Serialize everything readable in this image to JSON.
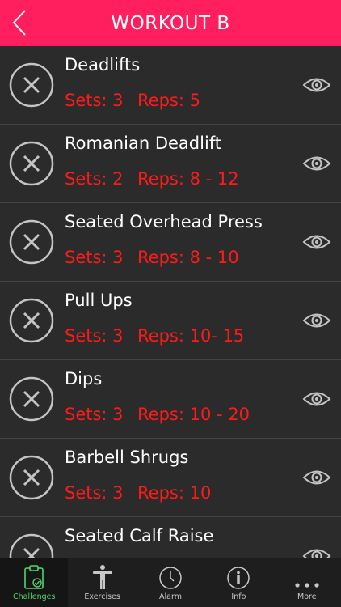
{
  "header": {
    "title": "WORKOUT B"
  },
  "exercises": [
    {
      "name": "Deadlifts",
      "sets": "Sets: 3",
      "reps": "Reps: 5"
    },
    {
      "name": "Romanian Deadlift",
      "sets": "Sets: 2",
      "reps": "Reps: 8 - 12"
    },
    {
      "name": "Seated Overhead Press",
      "sets": "Sets: 3",
      "reps": "Reps: 8 - 10"
    },
    {
      "name": "Pull Ups",
      "sets": "Sets: 3",
      "reps": "Reps: 10- 15"
    },
    {
      "name": "Dips",
      "sets": "Sets: 3",
      "reps": "Reps: 10 - 20"
    },
    {
      "name": "Barbell Shrugs",
      "sets": "Sets: 3",
      "reps": "Reps: 10"
    },
    {
      "name": "Seated Calf Raise",
      "sets": "",
      "reps": ""
    }
  ],
  "tabs": [
    {
      "label": "Challenges",
      "icon": "clipboard-check-icon",
      "active": true
    },
    {
      "label": "Exercises",
      "icon": "person-icon",
      "active": false
    },
    {
      "label": "Alarm",
      "icon": "clock-icon",
      "active": false
    },
    {
      "label": "Info",
      "icon": "info-icon",
      "active": false
    },
    {
      "label": "More",
      "icon": "more-dots-icon",
      "active": false
    }
  ],
  "colors": {
    "header": "#ff1f5e",
    "accent_text": "#ff1a1a",
    "active_tab": "#4ed66e",
    "background": "#2b2b2b"
  }
}
